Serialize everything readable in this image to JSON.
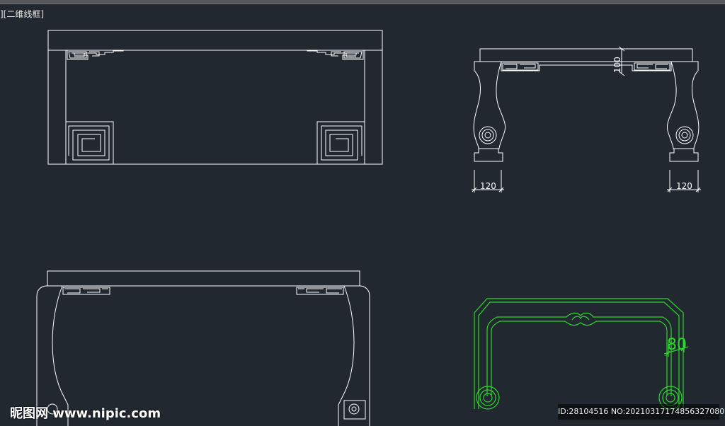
{
  "viewport": {
    "label": "[-][俯视][二维线框]",
    "visible_label": "][二维线框]"
  },
  "colors": {
    "background": "#212830",
    "line": "#ffffff",
    "selection": "#2bd82b"
  },
  "dimensions": {
    "leg_width_left": "120",
    "leg_width_right": "120",
    "apron_height": "100",
    "frame_width": "80"
  },
  "watermark": {
    "logo": "昵图网 www.nipic.com",
    "id_text": "ID:28104516 NO:20210317174856327080"
  }
}
